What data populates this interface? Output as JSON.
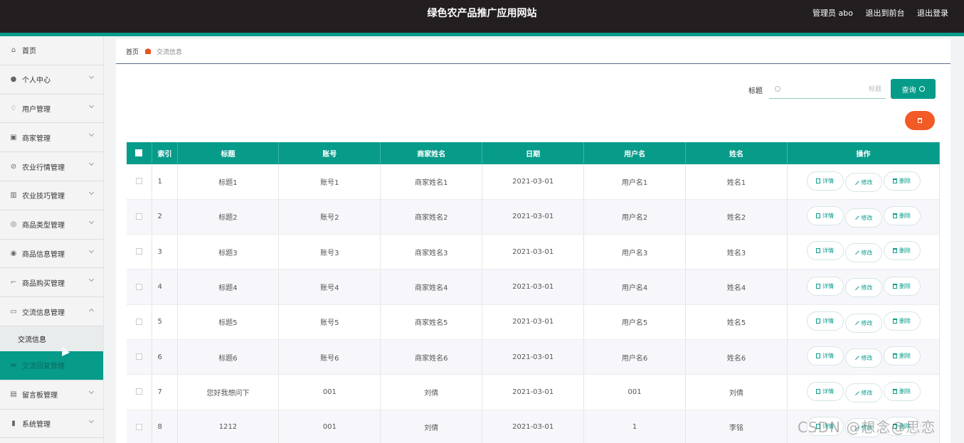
{
  "header": {
    "title": "绿色农产品推广应用网站",
    "user": "管理员 abo",
    "back_to_front": "退出到前台",
    "logout": "退出登录"
  },
  "sidebar": {
    "items": [
      {
        "label": "首页",
        "icon": "home-icon"
      },
      {
        "label": "个人中心",
        "icon": "user-icon"
      },
      {
        "label": "用户管理",
        "icon": "bell-icon"
      },
      {
        "label": "商家管理",
        "icon": "clipboard-icon"
      },
      {
        "label": "农业行情管理",
        "icon": "compass-icon"
      },
      {
        "label": "农业技巧管理",
        "icon": "bars-icon"
      },
      {
        "label": "商品类型管理",
        "icon": "gauge-icon"
      },
      {
        "label": "商品信息管理",
        "icon": "mic-icon"
      },
      {
        "label": "商品购买管理",
        "icon": "crop-icon"
      },
      {
        "label": "交流信息管理",
        "icon": "chat-icon"
      },
      {
        "label": "交流回复管理",
        "icon": "monitor-icon"
      },
      {
        "label": "留言板管理",
        "icon": "list-icon"
      },
      {
        "label": "系统管理",
        "icon": "chart-icon"
      }
    ],
    "sub_item": "交流信息"
  },
  "breadcrumb": {
    "home": "首页",
    "current": "交流信息"
  },
  "search": {
    "label": "标题",
    "placeholder": "标题",
    "button": "查询"
  },
  "table": {
    "headers": [
      "索引",
      "标题",
      "账号",
      "商家姓名",
      "日期",
      "用户名",
      "姓名",
      "操作"
    ],
    "actions": {
      "detail": "详情",
      "edit": "修改",
      "delete": "删除"
    },
    "rows": [
      {
        "idx": "1",
        "title": "标题1",
        "account": "账号1",
        "merchant": "商家姓名1",
        "date": "2021-03-01",
        "username": "用户名1",
        "name": "姓名1"
      },
      {
        "idx": "2",
        "title": "标题2",
        "account": "账号2",
        "merchant": "商家姓名2",
        "date": "2021-03-01",
        "username": "用户名2",
        "name": "姓名2"
      },
      {
        "idx": "3",
        "title": "标题3",
        "account": "账号3",
        "merchant": "商家姓名3",
        "date": "2021-03-01",
        "username": "用户名3",
        "name": "姓名3"
      },
      {
        "idx": "4",
        "title": "标题4",
        "account": "账号4",
        "merchant": "商家姓名4",
        "date": "2021-03-01",
        "username": "用户名4",
        "name": "姓名4"
      },
      {
        "idx": "5",
        "title": "标题5",
        "account": "账号5",
        "merchant": "商家姓名5",
        "date": "2021-03-01",
        "username": "用户名5",
        "name": "姓名5"
      },
      {
        "idx": "6",
        "title": "标题6",
        "account": "账号6",
        "merchant": "商家姓名6",
        "date": "2021-03-01",
        "username": "用户名6",
        "name": "姓名6"
      },
      {
        "idx": "7",
        "title": "您好我想问下",
        "account": "001",
        "merchant": "刘倩",
        "date": "2021-03-01",
        "username": "001",
        "name": "刘倩"
      },
      {
        "idx": "8",
        "title": "1212",
        "account": "001",
        "merchant": "刘倩",
        "date": "2021-03-01",
        "username": "1",
        "name": "李铭"
      }
    ]
  },
  "watermark": "CSDN @想念@思恋",
  "colors": {
    "accent": "#079b8a",
    "danger": "#f25a26",
    "topbar": "#231f20"
  }
}
